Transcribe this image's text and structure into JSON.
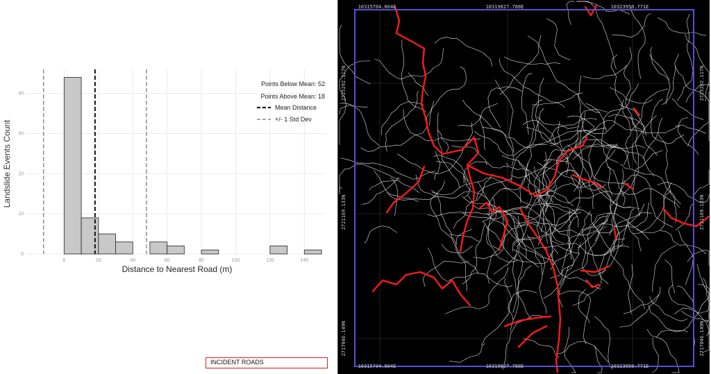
{
  "chart_data": {
    "type": "bar",
    "ylabel": "Landslide Events Count",
    "xlabel": "Distance to Nearest Road  (m)",
    "x_ticks": [
      0,
      20,
      40,
      60,
      80,
      100,
      120,
      140
    ],
    "y_ticks": [
      0,
      10,
      20,
      30,
      40
    ],
    "xlim": [
      -22,
      152
    ],
    "ylim": [
      0,
      46
    ],
    "bin_width": 10,
    "bins": [
      {
        "x0": 0,
        "x1": 10,
        "count": 44
      },
      {
        "x0": 10,
        "x1": 20,
        "count": 9
      },
      {
        "x0": 20,
        "x1": 30,
        "count": 5
      },
      {
        "x0": 30,
        "x1": 40,
        "count": 3
      },
      {
        "x0": 50,
        "x1": 60,
        "count": 3
      },
      {
        "x0": 60,
        "x1": 70,
        "count": 2
      },
      {
        "x0": 80,
        "x1": 90,
        "count": 1
      },
      {
        "x0": 120,
        "x1": 130,
        "count": 2
      },
      {
        "x0": 140,
        "x1": 150,
        "count": 1
      }
    ],
    "mean": 18,
    "std_lower": -12,
    "std_upper": 48,
    "bar_color": "#c8c8c8",
    "legend": {
      "points_below": "Points Below Mean: 52",
      "points_above": "Points Above Mean: 18",
      "mean_label": "Mean Distance",
      "std_label": "+/- 1 Std Dev"
    }
  },
  "map": {
    "coords_top": [
      "10315704.804E",
      "10319827.788E",
      "10323950.771E"
    ],
    "coords_bottom": [
      "10315704.804E",
      "10319827.788E",
      "10323950.771E"
    ],
    "coords_left": [
      "2725292.117N",
      "2721169.133N",
      "2717046.149N"
    ],
    "coords_right": [
      "2725292.117N",
      "2721169.133N",
      "2717046.149N"
    ],
    "frame_color": "#5a4fd8",
    "road_color": "#ff1a1a",
    "contour_color": "#e8e8e8"
  },
  "legend_label": "INCIDENT ROADS"
}
